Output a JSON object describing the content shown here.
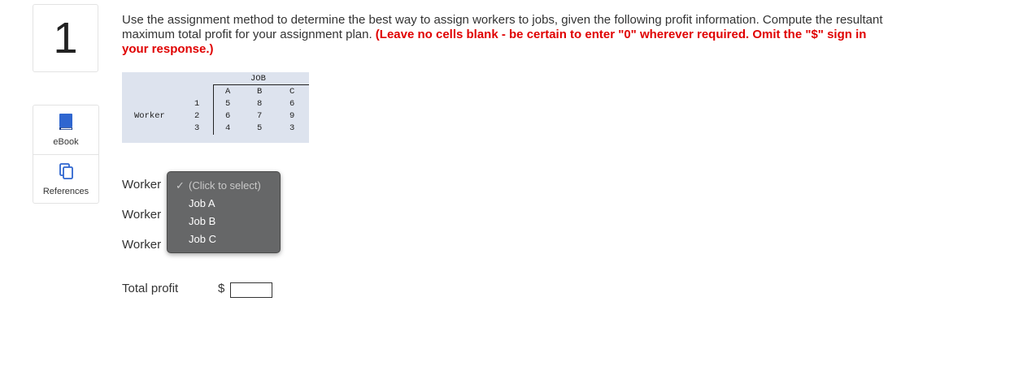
{
  "question": {
    "number": "1",
    "text_normal": "Use the assignment method to determine the best way to assign workers to jobs, given the following profit information. Compute the resultant maximum total profit for your assignment plan. ",
    "text_emphasis": "(Leave no cells blank - be certain to enter \"0\" wherever required. Omit the \"$\" sign in your response.)"
  },
  "sidebar": {
    "items": [
      {
        "label": "eBook",
        "icon": "book-icon"
      },
      {
        "label": "References",
        "icon": "references-icon"
      }
    ]
  },
  "profit_table": {
    "header": "JOB",
    "row_header": "Worker",
    "columns": [
      "A",
      "B",
      "C"
    ],
    "rows": [
      {
        "worker": "1",
        "values": [
          "5",
          "8",
          "6"
        ]
      },
      {
        "worker": "2",
        "values": [
          "6",
          "7",
          "9"
        ]
      },
      {
        "worker": "3",
        "values": [
          "4",
          "5",
          "3"
        ]
      }
    ]
  },
  "assignments": {
    "rows": [
      {
        "label": "Worker"
      },
      {
        "label": "Worker"
      },
      {
        "label": "Worker"
      }
    ],
    "dropdown": {
      "placeholder": "(Click to select)",
      "check": "✓",
      "options": [
        "Job A",
        "Job B",
        "Job C"
      ]
    }
  },
  "total": {
    "label": "Total profit",
    "currency": "$",
    "value": ""
  }
}
